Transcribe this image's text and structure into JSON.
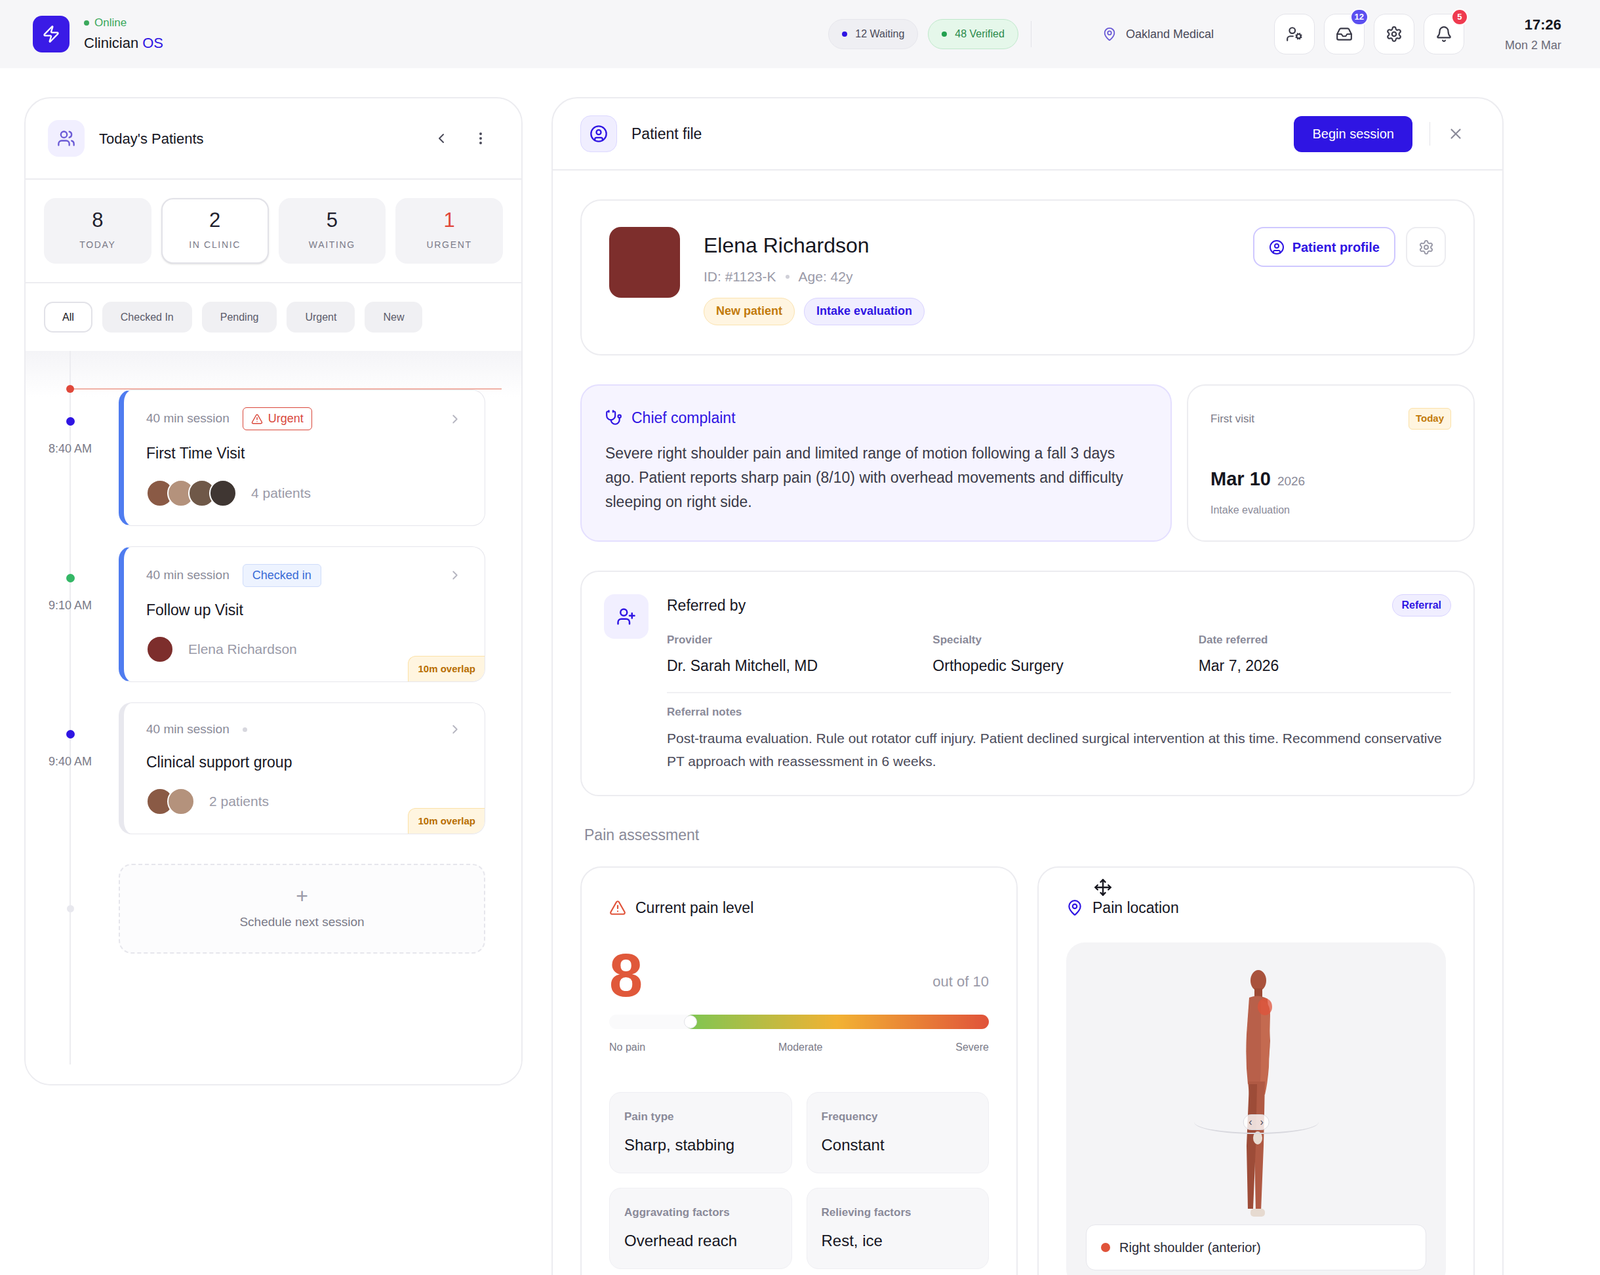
{
  "app": {
    "status": "Online",
    "name": "Clinician",
    "accent": "OS"
  },
  "queue_pills": [
    {
      "label": "12 Waiting",
      "kind": "neutral",
      "color": "#2f15e3"
    },
    {
      "label": "48 Verified",
      "kind": "success",
      "color": "#22a04f"
    }
  ],
  "location": "Oakland Medical",
  "toolbar": [
    {
      "kind": "profile",
      "badge": null,
      "color": null
    },
    {
      "kind": "inbox",
      "badge": "12",
      "color": "#5b4ff0"
    },
    {
      "kind": "settings",
      "badge": null,
      "color": null
    },
    {
      "kind": "notifications",
      "badge": "5",
      "color": "#ef3a4f"
    }
  ],
  "clock": {
    "time": "17:26",
    "date": "Mon 2 Mar"
  },
  "patients_panel": {
    "title": "Today's Patients",
    "stats": [
      {
        "value": "8",
        "label": "TODAY",
        "selected": false,
        "color": "#1f1f2e"
      },
      {
        "value": "2",
        "label": "IN CLINIC",
        "selected": true,
        "color": "#1f1f2e"
      },
      {
        "value": "5",
        "label": "WAITING",
        "selected": false,
        "color": "#1f1f2e"
      },
      {
        "value": "1",
        "label": "URGENT",
        "selected": false,
        "color": "#e0483a"
      }
    ],
    "filters": [
      {
        "label": "All",
        "selected": true
      },
      {
        "label": "Checked In",
        "selected": false
      },
      {
        "label": "Pending",
        "selected": false
      },
      {
        "label": "Urgent",
        "selected": false
      },
      {
        "label": "New",
        "selected": false
      }
    ],
    "sessions": [
      {
        "time": "8:40 AM",
        "dot_color": "#2f15e3",
        "accent": "#4f7cf0",
        "duration": "40 min session",
        "status": {
          "kind": "urgent",
          "label": "Urgent"
        },
        "title": "First Time Visit",
        "avatars": 4,
        "attendees": "4 patients",
        "overlap": null
      },
      {
        "time": "9:10 AM",
        "dot_color": "#34b766",
        "accent": "#4f7cf0",
        "duration": "40 min session",
        "status": {
          "kind": "checked",
          "label": "Checked in"
        },
        "title": "Follow up Visit",
        "avatars": 1,
        "attendees": "Elena Richardson",
        "overlap": "10m overlap"
      },
      {
        "time": "9:40 AM",
        "dot_color": "#2f15e3",
        "accent": "#e8e8ee",
        "duration": "40 min session",
        "status": {
          "kind": "none"
        },
        "title": "Clinical support group",
        "avatars": 2,
        "attendees": "2 patients",
        "overlap": "10m overlap"
      }
    ],
    "schedule": {
      "icon": "+",
      "label": "Schedule next session"
    }
  },
  "patient_file": {
    "title": "Patient file",
    "begin_button": "Begin session",
    "patient": {
      "name": "Elena Richardson",
      "id": "ID: #1123-K",
      "age": "Age: 42y",
      "tags": [
        {
          "label": "New patient",
          "kind": "amber"
        },
        {
          "label": "Intake evaluation",
          "kind": "indigo"
        }
      ],
      "profile_button": "Patient profile"
    },
    "chief_complaint": {
      "title": "Chief complaint",
      "text": "Severe right shoulder pain and limited range of motion following a fall 3 days ago. Patient reports sharp pain (8/10) with overhead movements and difficulty sleeping on right side."
    },
    "first_visit": {
      "label": "First visit",
      "badge": "Today",
      "date": "Mar 10",
      "year": "2026",
      "note": "Intake evaluation"
    },
    "referral": {
      "title": "Referred by",
      "badge": "Referral",
      "fields": [
        {
          "label": "Provider",
          "value": "Dr. Sarah Mitchell, MD"
        },
        {
          "label": "Specialty",
          "value": "Orthopedic Surgery"
        },
        {
          "label": "Date referred",
          "value": "Mar 7, 2026"
        }
      ],
      "notes_label": "Referral notes",
      "notes": "Post-trauma evaluation. Rule out rotator cuff injury. Patient declined surgical intervention at this time. Recommend conservative PT approach with reassessment in 6 weeks."
    },
    "pain_assessment": {
      "title": "Pain assessment",
      "level_card": {
        "title": "Current pain level",
        "value": "8",
        "scale": "out of 10",
        "level": 0.8,
        "ticks": [
          "No pain",
          "Moderate",
          "Severe"
        ],
        "details": [
          {
            "label": "Pain type",
            "value": "Sharp, stabbing"
          },
          {
            "label": "Frequency",
            "value": "Constant"
          },
          {
            "label": "Aggravating factors",
            "value": "Overhead reach"
          },
          {
            "label": "Relieving factors",
            "value": "Rest, ice"
          }
        ]
      },
      "location_card": {
        "title": "Pain location",
        "rotate": [
          "‹",
          "›"
        ],
        "marker": {
          "label": "Right shoulder (anterior)",
          "color": "#e0533a"
        }
      }
    }
  }
}
